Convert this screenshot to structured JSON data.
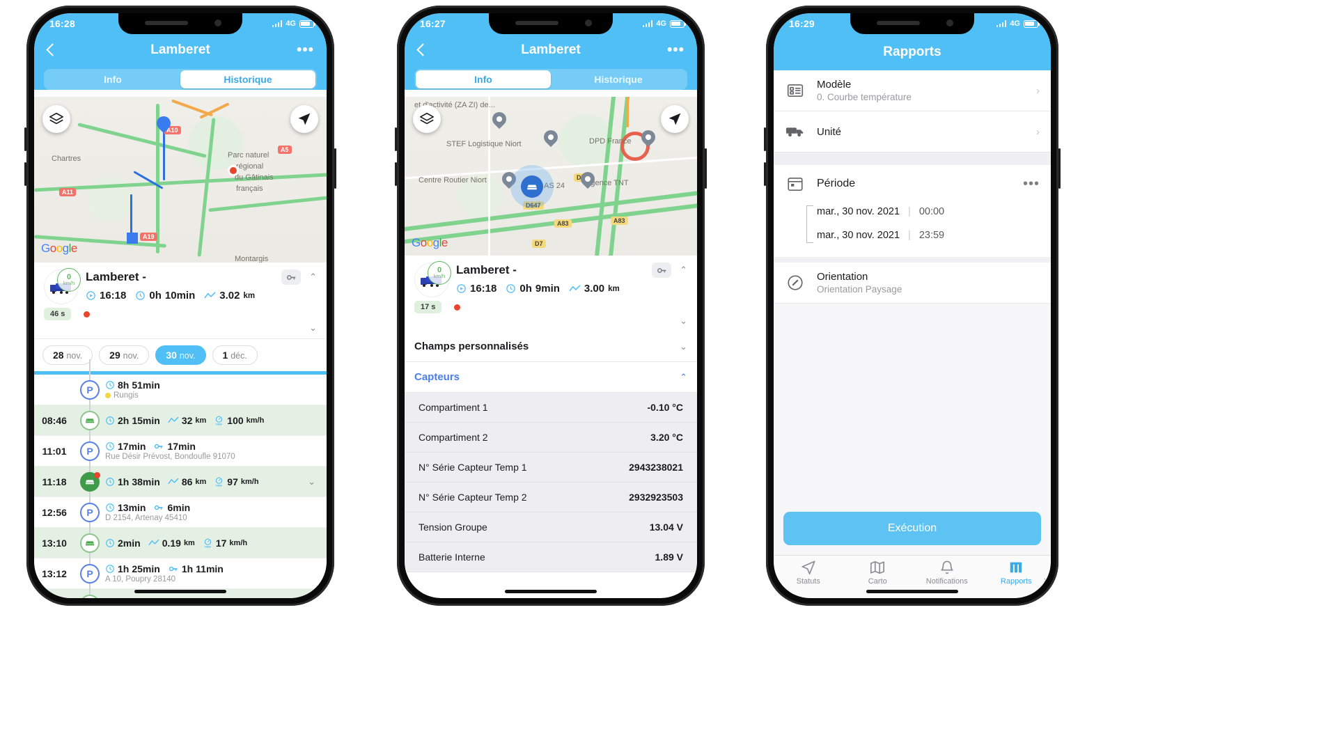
{
  "phone1": {
    "status": {
      "time": "16:28",
      "network": "4G"
    },
    "nav": {
      "title": "Lamberet",
      "back_icon": "chevron-left-icon",
      "more_icon": "more-horizontal-icon"
    },
    "segmented": {
      "tabs": [
        "Info",
        "Historique"
      ],
      "active": "Historique"
    },
    "map": {
      "google_logo": "Google",
      "labels": [
        "Chartres",
        "Parc naturel",
        "régional",
        "du Gâtinais",
        "français",
        "Montargis"
      ],
      "shields": [
        "A10",
        "A5",
        "A11",
        "A19"
      ],
      "layers_icon": "layers-icon",
      "locate_icon": "navigation-arrow-icon"
    },
    "vehicle": {
      "name": "Lamberet -",
      "speed_value": "0",
      "speed_unit": "km/h",
      "start_time": "16:18",
      "duration_h": "0h",
      "duration_m": "10min",
      "distance": "3.02",
      "distance_unit": "km",
      "key_icon": "key-icon",
      "badge": "46 s",
      "collapse_icon": "chevron-up-icon",
      "expand_icon": "chevron-down-icon"
    },
    "date_chips": [
      {
        "day": "28",
        "month": "nov.",
        "selected": false
      },
      {
        "day": "29",
        "month": "nov.",
        "selected": false
      },
      {
        "day": "30",
        "month": "nov.",
        "selected": true
      },
      {
        "day": "1",
        "month": "déc.",
        "selected": false
      }
    ],
    "trips": [
      {
        "time": "",
        "type": "park",
        "duration_a": "8h",
        "duration_b": "51min",
        "key_dur_a": "",
        "key_dur_b": "",
        "distance": "",
        "distance_unit": "",
        "speed": "",
        "speed_unit": "",
        "address": "Rungis",
        "has_dot": true,
        "alert": false,
        "filled": false,
        "chevron": false
      },
      {
        "time": "08:46",
        "type": "drive",
        "duration_a": "2h",
        "duration_b": "15min",
        "distance": "32",
        "distance_unit": "km",
        "speed": "100",
        "speed_unit": "km/h",
        "address": "",
        "has_dot": false,
        "alert": false,
        "filled": false,
        "chevron": false
      },
      {
        "time": "11:01",
        "type": "park",
        "duration_a": "",
        "duration_b": "17min",
        "key_dur_a": "",
        "key_dur_b": "17min",
        "distance": "",
        "distance_unit": "",
        "speed": "",
        "speed_unit": "",
        "address": "Rue Désir Prévost, Bondoufle 91070",
        "has_dot": false,
        "alert": false,
        "filled": false,
        "chevron": false
      },
      {
        "time": "11:18",
        "type": "drive",
        "duration_a": "1h",
        "duration_b": "38min",
        "distance": "86",
        "distance_unit": "km",
        "speed": "97",
        "speed_unit": "km/h",
        "address": "",
        "has_dot": false,
        "alert": true,
        "filled": true,
        "chevron": true
      },
      {
        "time": "12:56",
        "type": "park",
        "duration_a": "",
        "duration_b": "13min",
        "key_dur_a": "",
        "key_dur_b": "6min",
        "distance": "",
        "distance_unit": "",
        "speed": "",
        "speed_unit": "",
        "address": "D 2154, Artenay 45410",
        "has_dot": false,
        "alert": false,
        "filled": false,
        "chevron": false
      },
      {
        "time": "13:10",
        "type": "drive",
        "duration_a": "",
        "duration_b": "2min",
        "distance": "0.19",
        "distance_unit": "km",
        "speed": "17",
        "speed_unit": "km/h",
        "address": "",
        "has_dot": false,
        "alert": false,
        "filled": false,
        "chevron": false
      },
      {
        "time": "13:12",
        "type": "park",
        "duration_a": "1h",
        "duration_b": "25min",
        "key_dur_a": "1h",
        "key_dur_b": "11min",
        "distance": "",
        "distance_unit": "",
        "speed": "",
        "speed_unit": "",
        "address": "A 10, Poupry 28140",
        "has_dot": false,
        "alert": false,
        "filled": false,
        "chevron": false
      }
    ]
  },
  "phone2": {
    "status": {
      "time": "16:27",
      "network": "4G"
    },
    "nav": {
      "title": "Lamberet",
      "back_icon": "chevron-left-icon",
      "more_icon": "more-horizontal-icon"
    },
    "segmented": {
      "tabs": [
        "Info",
        "Historique"
      ],
      "active": "Info"
    },
    "map": {
      "google_logo": "Google",
      "labels": [
        "et d'activité (ZA ZI) de...",
        "STEF Logistique Niort",
        "DPD France",
        "Centre Routier Niort",
        "AS 24",
        "Agence TNT"
      ],
      "shields": [
        "D647",
        "D7",
        "A83",
        "A83",
        "D7"
      ],
      "layers_icon": "layers-icon",
      "locate_icon": "navigation-arrow-icon"
    },
    "vehicle": {
      "name": "Lamberet -",
      "speed_value": "0",
      "speed_unit": "km/h",
      "start_time": "16:18",
      "duration_h": "0h",
      "duration_m": "9min",
      "distance": "3.00",
      "distance_unit": "km",
      "key_icon": "key-icon",
      "badge": "17 s",
      "collapse_icon": "chevron-up-icon",
      "expand_icon": "chevron-down-icon"
    },
    "sections": [
      {
        "label": "Champs personnalisés",
        "expanded": false,
        "blue": false
      },
      {
        "label": "Capteurs",
        "expanded": true,
        "blue": true
      }
    ],
    "sensors": [
      {
        "name": "Compartiment 1",
        "value": "-0.10 °C"
      },
      {
        "name": "Compartiment 2",
        "value": "3.20 °C"
      },
      {
        "name": "N° Série Capteur Temp 1",
        "value": "2943238021"
      },
      {
        "name": "N° Série Capteur Temp 2",
        "value": "2932923503"
      },
      {
        "name": "Tension Groupe",
        "value": "13.04 V"
      },
      {
        "name": "Batterie Interne",
        "value": "1.89 V"
      }
    ]
  },
  "phone3": {
    "status": {
      "time": "16:29",
      "network": "4G"
    },
    "nav": {
      "title": "Rapports"
    },
    "rows": [
      {
        "icon": "report-template-icon",
        "title": "Modèle",
        "sub": "0. Courbe température",
        "chevron": "chevron-right-icon"
      },
      {
        "icon": "truck-icon",
        "title": "Unité",
        "sub": "",
        "chevron": "chevron-right-icon"
      }
    ],
    "period": {
      "icon": "calendar-icon",
      "title": "Période",
      "more_icon": "more-horizontal-icon",
      "from": {
        "date": "mar., 30 nov. 2021",
        "time": "00:00"
      },
      "to": {
        "date": "mar., 30 nov. 2021",
        "time": "23:59"
      }
    },
    "orientation": {
      "icon": "orientation-icon",
      "title": "Orientation",
      "sub": "Orientation Paysage"
    },
    "execute_button": "Exécution",
    "tabbar": {
      "items": [
        {
          "label": "Statuts",
          "icon": "navigation-arrow-icon",
          "active": false
        },
        {
          "label": "Carto",
          "icon": "map-icon",
          "active": false
        },
        {
          "label": "Notifications",
          "icon": "bell-icon",
          "active": false
        },
        {
          "label": "Rapports",
          "icon": "grid-icon",
          "active": true
        }
      ],
      "overflow_icon": "chevron-right-icon"
    }
  }
}
